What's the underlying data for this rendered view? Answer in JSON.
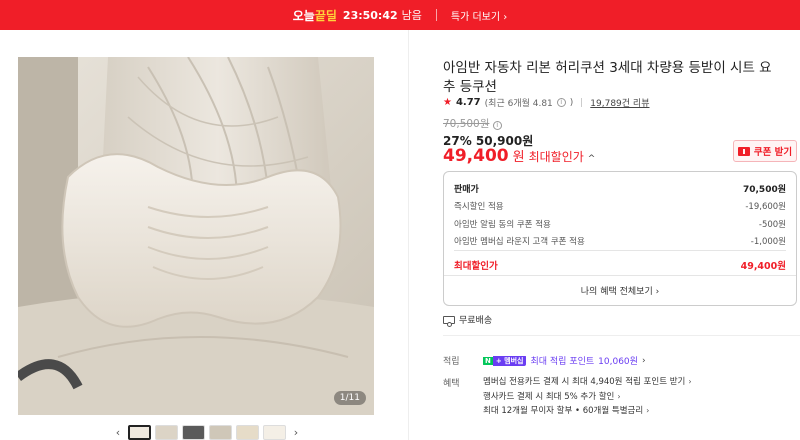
{
  "topbar": {
    "brand_prefix": "오늘",
    "brand_suffix": "끝딜",
    "timer": "23:50:42",
    "timer_suffix": "남음",
    "more_link": "특가 더보기 ›"
  },
  "gallery": {
    "pager": "1/11",
    "thumbnail_colors": [
      "#efe9df",
      "#dcd4c6",
      "#5a5a5a",
      "#cfc7b8",
      "#e6dcc8",
      "#f4efe6"
    ],
    "prev_icon": "chevron-left-icon",
    "next_icon": "chevron-right-icon"
  },
  "product": {
    "title": "아임반 자동차 리본 허리쿠션 3세대 차량용 등받이 시트 요추 등쿠션",
    "rating_star": "★",
    "rating_score": "4.77",
    "rating_note": "(최근 6개월 4.81",
    "rating_note_close": ")",
    "review_count": "19,789건 리뷰",
    "original_price": "70,500원",
    "discount_pct": "27%",
    "discount_price": "50,900원",
    "max_price_amount": "49,400",
    "max_price_unit": "원",
    "max_price_label": "최대할인가",
    "coupon_button": "쿠폰 받기"
  },
  "price_box": {
    "rows": [
      {
        "label": "판매가",
        "value": "70,500원"
      },
      {
        "label": "즉시할인 적용",
        "value": "-19,600원"
      },
      {
        "label": "아임반 알림 동의 쿠폰 적용",
        "value": "-500원"
      },
      {
        "label": "아임반 멤버십 라운지 고객 쿠폰 적용",
        "value": "-1,000원"
      }
    ],
    "total_label": "최대할인가",
    "total_value": "49,400원",
    "footer": "나의 혜택 전체보기 ›"
  },
  "shipping": {
    "label": "무료배송"
  },
  "points": {
    "label": "적립",
    "badge_n": "N",
    "badge_plus": "+ 멤버십",
    "text": "최대 적립 포인트",
    "value": "10,060원",
    "chev": "›"
  },
  "benefits": {
    "label": "혜택",
    "items": [
      "멤버십 전용카드 결제 시 최대 4,940원 적립 포인트 받기",
      "행사카드 결제 시 최대 5% 추가 할인",
      "최대 12개월 무이자 할부 • 60개월 특별금리"
    ]
  },
  "colors": {
    "brand_red": "#f01e28",
    "naver_green": "#03c75a",
    "membership_purple": "#6a3df2"
  }
}
